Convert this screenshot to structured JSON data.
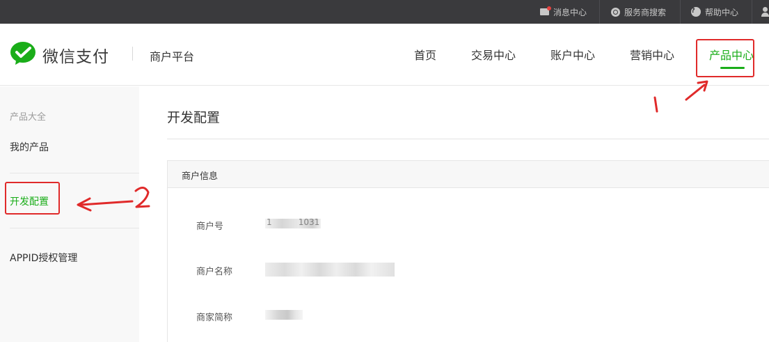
{
  "topbar": {
    "items": [
      {
        "label": "消息中心",
        "icon": "mail-icon"
      },
      {
        "label": "服务商搜索",
        "icon": "search-icon"
      },
      {
        "label": "帮助中心",
        "icon": "help-icon"
      }
    ],
    "help_glyph": "?"
  },
  "header": {
    "logo_text": "微信支付",
    "platform_title": "商户平台",
    "nav": [
      {
        "label": "首页",
        "active": false
      },
      {
        "label": "交易中心",
        "active": false
      },
      {
        "label": "账户中心",
        "active": false
      },
      {
        "label": "营销中心",
        "active": false
      },
      {
        "label": "产品中心",
        "active": true
      }
    ]
  },
  "sidebar": {
    "heading": "产品大全",
    "items": [
      {
        "label": "我的产品",
        "active": false
      },
      {
        "label": "开发配置",
        "active": true
      },
      {
        "label": "APPID授权管理",
        "active": false
      }
    ]
  },
  "main": {
    "page_title": "开发配置",
    "panel_title": "商户信息",
    "fields": [
      {
        "label": "商户号",
        "value_visible": "1          1031"
      },
      {
        "label": "商户名称",
        "value_visible": ""
      },
      {
        "label": "商家简称",
        "value_visible": ""
      }
    ]
  },
  "annotations": {
    "labels": [
      "1",
      "2"
    ]
  },
  "colors": {
    "accent": "#1aad19",
    "topbar_bg": "#3a3a3d",
    "annotation": "#e02a2a"
  }
}
